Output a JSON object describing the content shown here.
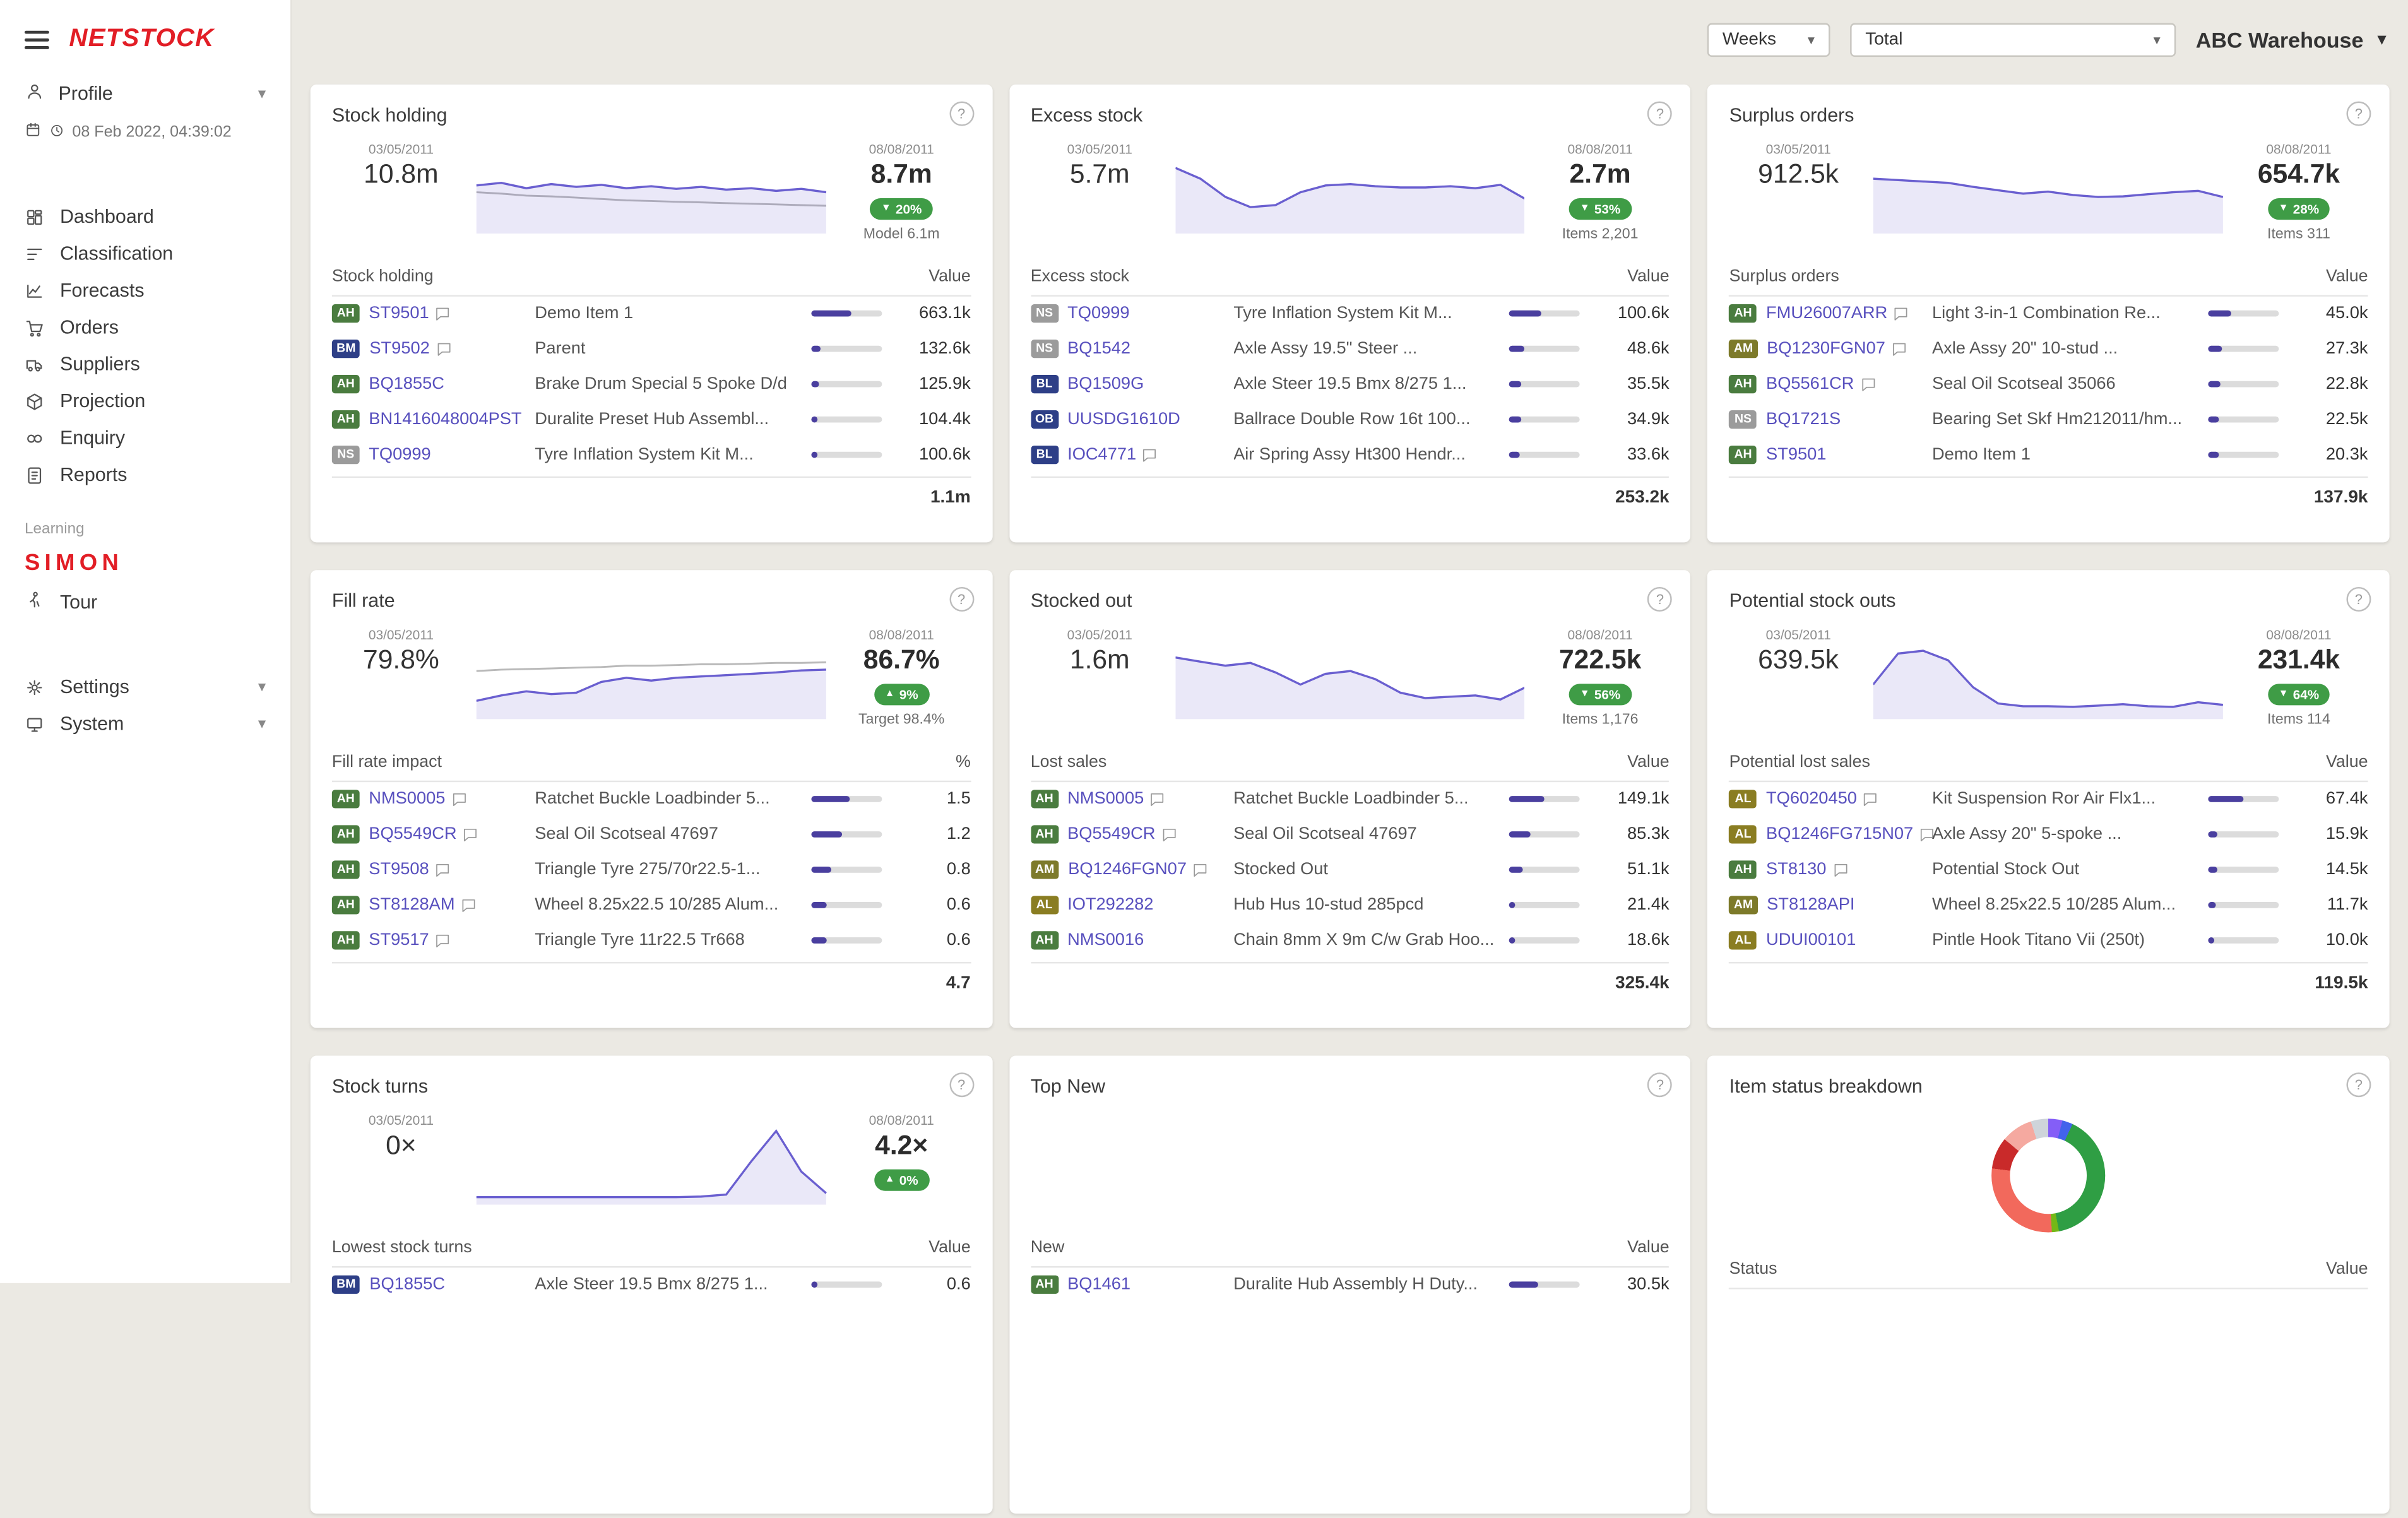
{
  "topbar": {
    "period_select": {
      "value": "Weeks"
    },
    "filter_select": {
      "value": "Total"
    },
    "warehouse": {
      "value": "ABC Warehouse"
    }
  },
  "sidebar": {
    "logo": "NETSTOCK",
    "profile": {
      "label": "Profile"
    },
    "datetime": "08 Feb 2022, 04:39:02",
    "nav": [
      {
        "label": "Dashboard",
        "icon": "dashboard"
      },
      {
        "label": "Classification",
        "icon": "classification"
      },
      {
        "label": "Forecasts",
        "icon": "forecasts"
      },
      {
        "label": "Orders",
        "icon": "orders"
      },
      {
        "label": "Suppliers",
        "icon": "suppliers"
      },
      {
        "label": "Projection",
        "icon": "projection"
      },
      {
        "label": "Enquiry",
        "icon": "enquiry"
      },
      {
        "label": "Reports",
        "icon": "reports"
      }
    ],
    "learning_label": "Learning",
    "learning_logo": "SIMON",
    "tour": {
      "label": "Tour",
      "icon": "tour"
    },
    "bottom": [
      {
        "label": "Settings",
        "icon": "settings"
      },
      {
        "label": "System",
        "icon": "system"
      }
    ]
  },
  "colors": {
    "accent_link": "#5850be",
    "chart_line": "#6a5fd0",
    "chart_fill": "rgba(106,95,208,0.14)",
    "chart_gray": "#b9b9b9",
    "chip_green": "#3f9c46",
    "bar_fill": "#4a3f9f",
    "logo_red": "#e21e26",
    "badge_colors": {
      "AH": "#4a7c3f",
      "BM": "#2e3f87",
      "NS": "#9b9b9b",
      "BL": "#2e3f87",
      "OB": "#2e3f87",
      "AM": "#7d7a2a",
      "AL": "#8a7d22"
    }
  },
  "cards": [
    {
      "title": "Stock holding",
      "stats": {
        "left": {
          "date": "03/05/2011",
          "value": "10.8m"
        },
        "right": {
          "date": "08/08/2011",
          "value": "8.7m",
          "change": "20%",
          "dir": "down",
          "subtext": "Model 6.1m"
        }
      },
      "spark": {
        "purple": [
          62,
          66,
          58,
          64,
          60,
          63,
          58,
          61,
          57,
          60,
          56,
          58,
          54,
          57,
          52
        ],
        "gray": [
          52,
          50,
          47,
          46,
          44,
          42,
          40,
          39,
          38,
          37,
          36,
          35,
          34,
          33,
          32
        ]
      },
      "table": {
        "left_header": "Stock holding",
        "right_header": "Value",
        "rows": [
          {
            "badge": "AH",
            "code": "ST9501",
            "comment": true,
            "name": "Demo Item 1",
            "bar": 58,
            "value": "663.1k"
          },
          {
            "badge": "BM",
            "code": "ST9502",
            "comment": true,
            "name": "Parent",
            "bar": 13,
            "value": "132.6k"
          },
          {
            "badge": "AH",
            "code": "BQ1855C",
            "comment": false,
            "name": "Brake Drum Special 5 Spoke D/d",
            "bar": 12,
            "value": "125.9k"
          },
          {
            "badge": "AH",
            "code": "BN1416048004PST",
            "comment": false,
            "name": "Duralite Preset Hub Assembl...",
            "bar": 10,
            "value": "104.4k"
          },
          {
            "badge": "NS",
            "code": "TQ0999",
            "comment": false,
            "name": "Tyre Inflation System Kit M...",
            "bar": 10,
            "value": "100.6k"
          }
        ],
        "total": "1.1m"
      }
    },
    {
      "title": "Excess stock",
      "stats": {
        "left": {
          "date": "03/05/2011",
          "value": "5.7m"
        },
        "right": {
          "date": "08/08/2011",
          "value": "2.7m",
          "change": "53%",
          "dir": "down",
          "subtext": "Items 2,201"
        }
      },
      "spark": {
        "purple": [
          88,
          72,
          45,
          30,
          33,
          52,
          62,
          64,
          61,
          59,
          59,
          61,
          58,
          63,
          42
        ]
      },
      "table": {
        "left_header": "Excess stock",
        "right_header": "Value",
        "rows": [
          {
            "badge": "NS",
            "code": "TQ0999",
            "comment": false,
            "name": "Tyre Inflation System Kit M...",
            "bar": 45,
            "value": "100.6k"
          },
          {
            "badge": "NS",
            "code": "BQ1542",
            "comment": false,
            "name": "Axle Assy 19.5\" Steer ...",
            "bar": 22,
            "value": "48.6k"
          },
          {
            "badge": "BL",
            "code": "BQ1509G",
            "comment": false,
            "name": "Axle Steer 19.5 Bmx 8/275 1...",
            "bar": 17,
            "value": "35.5k"
          },
          {
            "badge": "OB",
            "code": "UUSDG1610D",
            "comment": false,
            "name": "Ballrace Double Row 16t 100...",
            "bar": 16,
            "value": "34.9k"
          },
          {
            "badge": "BL",
            "code": "IOC4771",
            "comment": true,
            "name": "Air Spring Assy Ht300 Hendr...",
            "bar": 15,
            "value": "33.6k"
          }
        ],
        "total": "253.2k"
      }
    },
    {
      "title": "Surplus orders",
      "stats": {
        "left": {
          "date": "03/05/2011",
          "value": "912.5k"
        },
        "right": {
          "date": "08/08/2011",
          "value": "654.7k",
          "change": "28%",
          "dir": "down",
          "subtext": "Items 311"
        }
      },
      "spark": {
        "purple": [
          72,
          70,
          68,
          66,
          60,
          55,
          50,
          53,
          48,
          45,
          46,
          49,
          52,
          54,
          45
        ]
      },
      "table": {
        "left_header": "Surplus orders",
        "right_header": "Value",
        "rows": [
          {
            "badge": "AH",
            "code": "FMU26007ARR",
            "comment": true,
            "name": "Light 3-in-1 Combination Re...",
            "bar": 33,
            "value": "45.0k"
          },
          {
            "badge": "AM",
            "code": "BQ1230FGN07",
            "comment": true,
            "name": "Axle Assy 20\" 10-stud ...",
            "bar": 20,
            "value": "27.3k"
          },
          {
            "badge": "AH",
            "code": "BQ5561CR",
            "comment": true,
            "name": "Seal Oil Scotseal 35066",
            "bar": 17,
            "value": "22.8k"
          },
          {
            "badge": "NS",
            "code": "BQ1721S",
            "comment": false,
            "name": "Bearing Set Skf Hm212011/hm...",
            "bar": 16,
            "value": "22.5k"
          },
          {
            "badge": "AH",
            "code": "ST9501",
            "comment": false,
            "name": "Demo Item 1",
            "bar": 15,
            "value": "20.3k"
          }
        ],
        "total": "137.9k"
      }
    },
    {
      "title": "Fill rate",
      "stats": {
        "left": {
          "date": "03/05/2011",
          "value": "79.8%"
        },
        "right": {
          "date": "08/08/2011",
          "value": "86.7%",
          "change": "9%",
          "dir": "up",
          "subtext": "Target 98.4%"
        }
      },
      "spark": {
        "purple": [
          18,
          26,
          32,
          28,
          30,
          46,
          52,
          48,
          52,
          54,
          56,
          58,
          60,
          63,
          64
        ],
        "gray": [
          62,
          64,
          65,
          66,
          67,
          68,
          70,
          70,
          71,
          72,
          72,
          73,
          74,
          74,
          75
        ]
      },
      "table": {
        "left_header": "Fill rate impact",
        "right_header": "%",
        "rows": [
          {
            "badge": "AH",
            "code": "NMS0005",
            "comment": true,
            "name": "Ratchet Buckle Loadbinder 5...",
            "bar": 55,
            "value": "1.5"
          },
          {
            "badge": "AH",
            "code": "BQ5549CR",
            "comment": true,
            "name": "Seal Oil Scotseal 47697",
            "bar": 44,
            "value": "1.2"
          },
          {
            "badge": "AH",
            "code": "ST9508",
            "comment": true,
            "name": "Triangle Tyre 275/70r22.5-1...",
            "bar": 30,
            "value": "0.8"
          },
          {
            "badge": "AH",
            "code": "ST8128AM",
            "comment": true,
            "name": "Wheel 8.25x22.5 10/285 Alum...",
            "bar": 22,
            "value": "0.6"
          },
          {
            "badge": "AH",
            "code": "ST9517",
            "comment": true,
            "name": "Triangle Tyre 11r22.5 Tr668",
            "bar": 22,
            "value": "0.6"
          }
        ],
        "total": "4.7"
      }
    },
    {
      "title": "Stocked out",
      "stats": {
        "left": {
          "date": "03/05/2011",
          "value": "1.6m"
        },
        "right": {
          "date": "08/08/2011",
          "value": "722.5k",
          "change": "56%",
          "dir": "down",
          "subtext": "Items 1,176"
        }
      },
      "spark": {
        "purple": [
          82,
          76,
          70,
          74,
          60,
          42,
          58,
          62,
          50,
          30,
          22,
          24,
          26,
          20,
          38
        ]
      },
      "table": {
        "left_header": "Lost sales",
        "right_header": "Value",
        "rows": [
          {
            "badge": "AH",
            "code": "NMS0005",
            "comment": true,
            "name": "Ratchet Buckle Loadbinder 5...",
            "bar": 50,
            "value": "149.1k"
          },
          {
            "badge": "AH",
            "code": "BQ5549CR",
            "comment": true,
            "name": "Seal Oil Scotseal 47697",
            "bar": 29,
            "value": "85.3k"
          },
          {
            "badge": "AM",
            "code": "BQ1246FGN07",
            "comment": true,
            "name": "Stocked Out",
            "bar": 18,
            "value": "51.1k"
          },
          {
            "badge": "AL",
            "code": "IOT292282",
            "comment": false,
            "name": "Hub Hus 10-stud 285pcd",
            "bar": 8,
            "value": "21.4k"
          },
          {
            "badge": "AH",
            "code": "NMS0016",
            "comment": false,
            "name": "Chain 8mm X 9m C/w Grab Hoo...",
            "bar": 7,
            "value": "18.6k"
          }
        ],
        "total": "325.4k"
      }
    },
    {
      "title": "Potential stock outs",
      "stats": {
        "left": {
          "date": "03/05/2011",
          "value": "639.5k"
        },
        "right": {
          "date": "08/08/2011",
          "value": "231.4k",
          "change": "64%",
          "dir": "down",
          "subtext": "Items 114"
        }
      },
      "spark": {
        "purple": [
          42,
          88,
          92,
          78,
          38,
          14,
          10,
          10,
          9,
          11,
          13,
          10,
          9,
          16,
          12
        ]
      },
      "table": {
        "left_header": "Potential lost sales",
        "right_header": "Value",
        "rows": [
          {
            "badge": "AL",
            "code": "TQ6020450",
            "comment": true,
            "name": "Kit Suspension Ror Air Flx1...",
            "bar": 50,
            "value": "67.4k"
          },
          {
            "badge": "AL",
            "code": "BQ1246FG715N07",
            "comment": true,
            "name": "Axle Assy 20\" 5-spoke ...",
            "bar": 13,
            "value": "15.9k"
          },
          {
            "badge": "AH",
            "code": "ST8130",
            "comment": true,
            "name": "Potential Stock Out",
            "bar": 12,
            "value": "14.5k"
          },
          {
            "badge": "AM",
            "code": "ST8128API",
            "comment": false,
            "name": "Wheel 8.25x22.5 10/285 Alum...",
            "bar": 10,
            "value": "11.7k"
          },
          {
            "badge": "AL",
            "code": "UDUI00101",
            "comment": false,
            "name": "Pintle Hook Titano Vii (250t)",
            "bar": 9,
            "value": "10.0k"
          }
        ],
        "total": "119.5k"
      }
    },
    {
      "title": "Stock turns",
      "stats": {
        "left": {
          "date": "03/05/2011",
          "value": "0×"
        },
        "right": {
          "date": "08/08/2011",
          "value": "4.2×",
          "change": "0%",
          "dir": "up",
          "subtext": ""
        }
      },
      "spark": {
        "purple": [
          2,
          2,
          2,
          2,
          2,
          2,
          2,
          2,
          2,
          3,
          6,
          55,
          100,
          40,
          8
        ]
      },
      "table": {
        "left_header": "Lowest stock turns",
        "right_header": "Value",
        "rows": [
          {
            "badge": "BM",
            "code": "BQ1855C",
            "comment": false,
            "name": "Axle Steer 19.5 Bmx 8/275 1...",
            "bar": 10,
            "value": "0.6"
          }
        ]
      }
    },
    {
      "title": "Top New",
      "spacer": 80,
      "table": {
        "left_header": "New",
        "right_header": "Value",
        "rows": [
          {
            "badge": "AH",
            "code": "BQ1461",
            "comment": false,
            "name": "Duralite Hub Assembly H Duty...",
            "bar": 40,
            "value": "30.5k"
          }
        ]
      }
    },
    {
      "title": "Item status breakdown",
      "donut": {
        "segments": [
          {
            "color": "#845ef7",
            "pct": 4
          },
          {
            "color": "#4263eb",
            "pct": 3
          },
          {
            "color": "#2f9e44",
            "pct": 40
          },
          {
            "color": "#74b816",
            "pct": 2
          },
          {
            "color": "#f2695c",
            "pct": 28
          },
          {
            "color": "#c92a2a",
            "pct": 9
          },
          {
            "color": "#f5a9a0",
            "pct": 9
          },
          {
            "color": "#ced4da",
            "pct": 5
          }
        ]
      },
      "table": {
        "left_header": "Status",
        "right_header": "Value",
        "rows": []
      }
    }
  ]
}
